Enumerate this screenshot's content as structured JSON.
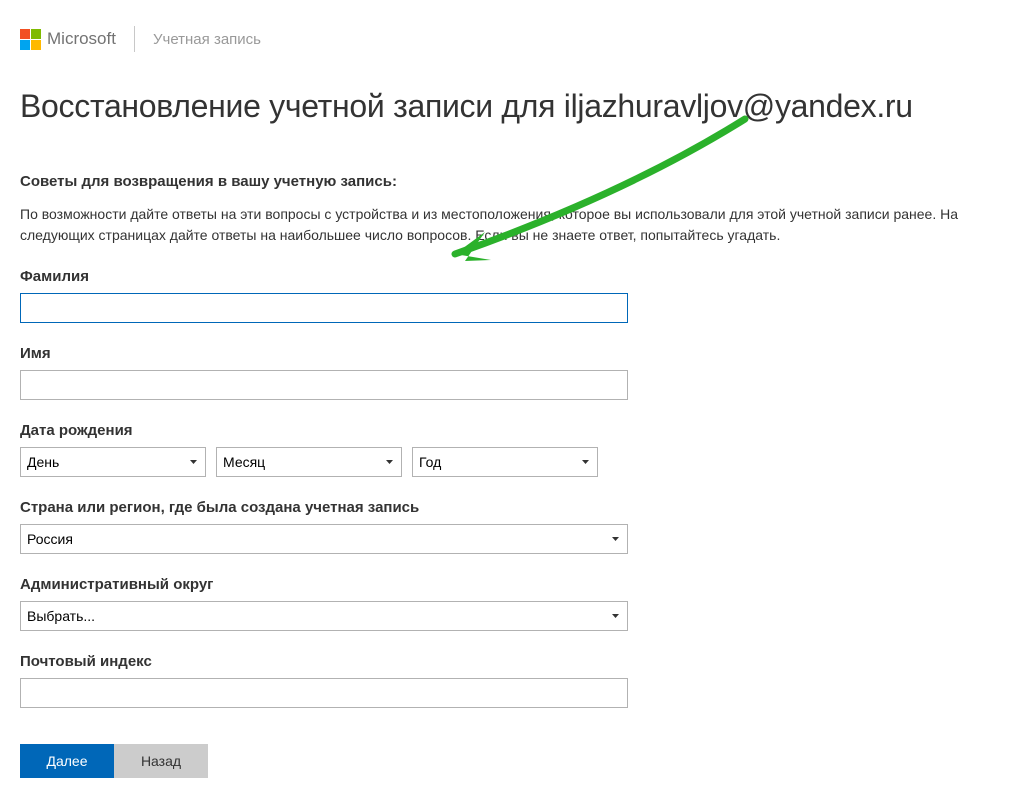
{
  "header": {
    "brand": "Microsoft",
    "section": "Учетная запись"
  },
  "page": {
    "title_prefix": "Восстановление учетной записи для ",
    "email": "iljazhuravljov@yandex.ru",
    "tips_heading": "Советы для возвращения в вашу учетную запись:",
    "tips_text": "По возможности дайте ответы на эти вопросы с устройства и из местоположения, которое вы использовали для этой учетной записи ранее. На следующих страницах дайте ответы на наибольшее число вопросов. Если вы не знаете ответ, попытайтесь угадать."
  },
  "form": {
    "lastname_label": "Фамилия",
    "lastname_value": "",
    "firstname_label": "Имя",
    "firstname_value": "",
    "dob_label": "Дата рождения",
    "dob_day": "День",
    "dob_month": "Месяц",
    "dob_year": "Год",
    "country_label": "Страна или регион, где была создана учетная запись",
    "country_value": "Россия",
    "region_label": "Административный округ",
    "region_value": "Выбрать...",
    "postal_label": "Почтовый индекс",
    "postal_value": ""
  },
  "buttons": {
    "next": "Далее",
    "back": "Назад"
  }
}
